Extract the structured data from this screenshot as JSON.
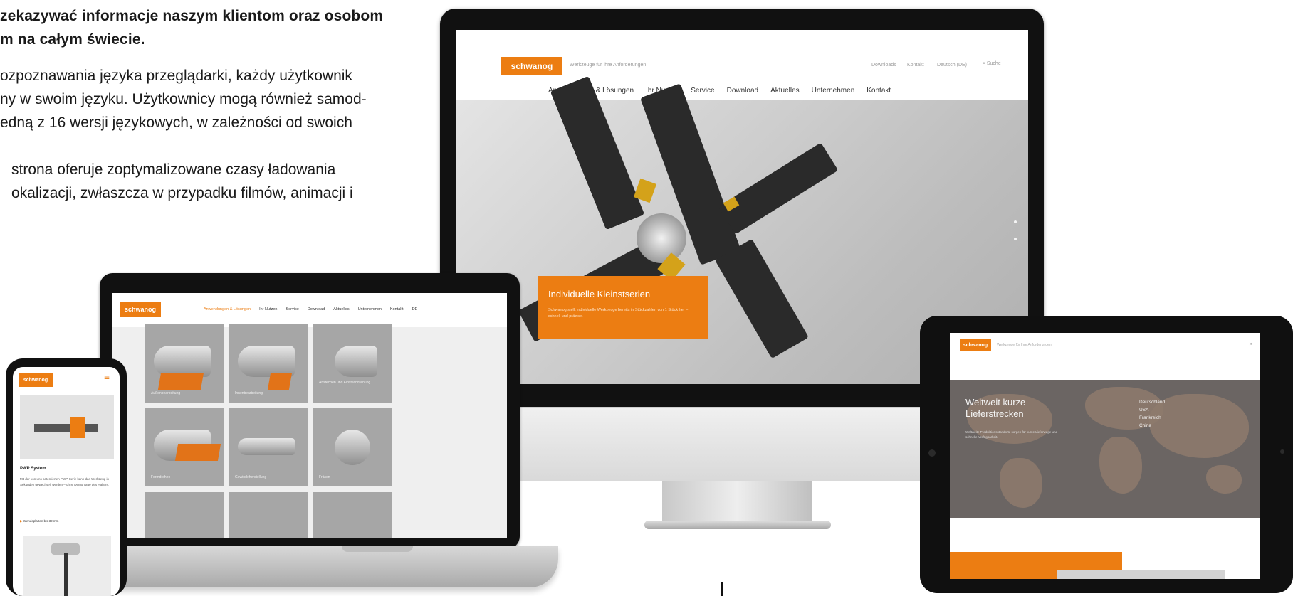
{
  "article": {
    "lead_lines": [
      "zekazywać informacje naszym klientom oraz osobom",
      "m na całym świecie."
    ],
    "para1_lines": [
      "ozpoznawania języka przeglądarki, każdy użytkownik",
      "ny w swoim języku. Użytkownicy mogą również samod-",
      "edną z 16 wersji językowych, w zależności od swoich"
    ],
    "para2_lines": [
      "strona oferuje zoptymalizowane czasy ładowania",
      "okalizacji, zwłaszcza w przypadku filmów, animacji i"
    ]
  },
  "brand": {
    "logo_text": "schwanog",
    "accent_color": "#ec7d12"
  },
  "imac_site": {
    "tagline": "Werkzeuge für Ihre Anforderungen",
    "util_links": [
      "Downloads",
      "Kontakt",
      "Deutsch (DE)"
    ],
    "search_label": "Suche",
    "nav": [
      "Anwendungen & Lösungen",
      "Ihr Nutzen",
      "Service",
      "Download",
      "Aktuelles",
      "Unternehmen",
      "Kontakt"
    ],
    "hero_title": "Individuelle Kleinstserien",
    "hero_text": "Schwanog stellt individuelle Werkzeuge bereits in Stückzahlen von 1 Stück her – schnell und präzise."
  },
  "laptop_site": {
    "nav": [
      "Anwendungen & Lösungen",
      "Ihr Nutzen",
      "Service",
      "Download",
      "Aktuelles",
      "Unternehmen",
      "Kontakt",
      "DE"
    ],
    "tiles": [
      "Außenbearbeitung",
      "Innenbearbeitung",
      "Abstechen und Einstechdrehung",
      "Formdrehen",
      "Gewindeherstellung",
      "Fräsen"
    ]
  },
  "phone_site": {
    "product_title": "PWP System",
    "body": "Mit der von uns patentierten PWP-Serie kann das Werkzeug in Sekunden gewechselt werden – ohne Demontage des Halters.",
    "bullet": "Wendeplatten bis 32 mm"
  },
  "ipad_site": {
    "tagline": "Werkzeuge für Ihre Anforderungen",
    "close_label": "✕",
    "map_title": "Weltweit kurze Lieferstrecken",
    "map_text": "Weltweite Produktionsstandorte sorgen für kurze Lieferwege und schnelle Verfügbarkeit.",
    "countries": [
      "Deutschland",
      "USA",
      "Frankreich",
      "China"
    ]
  }
}
